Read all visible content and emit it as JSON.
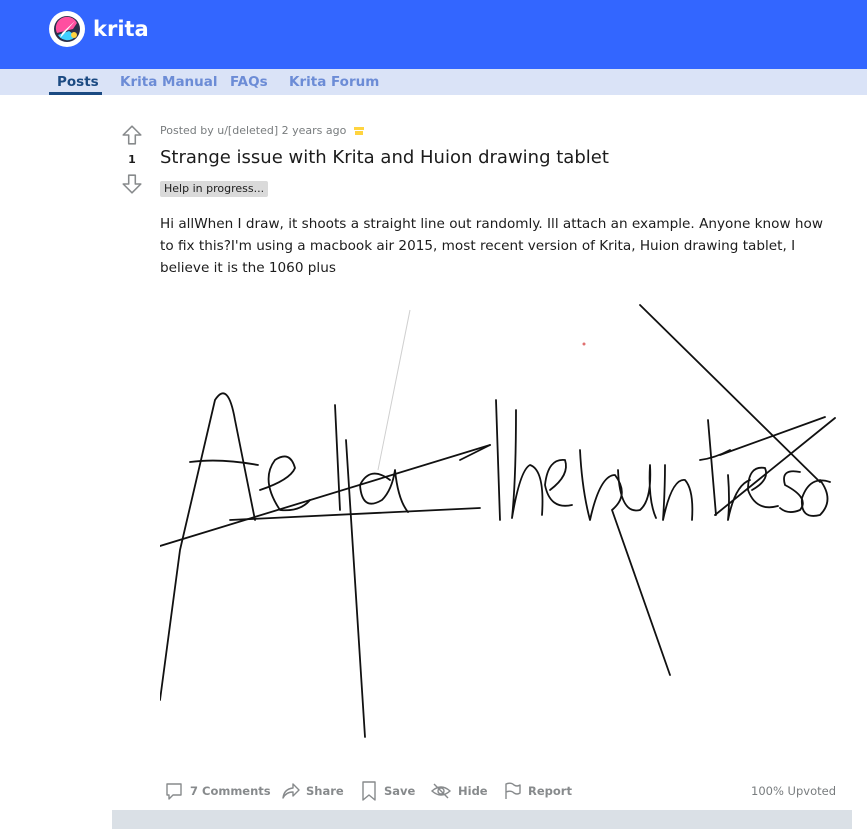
{
  "community": {
    "name": "krita",
    "brand_color": "#3366ff",
    "logo_icon": "krita-logo-icon"
  },
  "nav": {
    "tabs": [
      {
        "label": "Posts",
        "active": true
      },
      {
        "label": "Krita Manual",
        "active": false
      },
      {
        "label": "FAQs",
        "active": false
      },
      {
        "label": "Krita Forum",
        "active": false
      }
    ],
    "active_color": "#1b4a82",
    "inactive_color": "#6c8cd6"
  },
  "post": {
    "vote_count": "1",
    "meta": "Posted by u/[deleted] 2 years ago",
    "title": "Strange issue with Krita and Huion drawing tablet",
    "flair": "Help in progress...",
    "body": "Hi allWhen I draw, it shoots a straight line out randomly. Ill attach an example. Anyone know how to fix this?I'm using a macbook air 2015, most recent version of Krita, Huion drawing tablet, I believe it is the 1060 plus",
    "image_alt_icon": "handwriting-sketch-image"
  },
  "actions": {
    "comments": "7 Comments",
    "share": "Share",
    "save": "Save",
    "hide": "Hide",
    "report": "Report",
    "upvoted": "100% Upvoted"
  }
}
